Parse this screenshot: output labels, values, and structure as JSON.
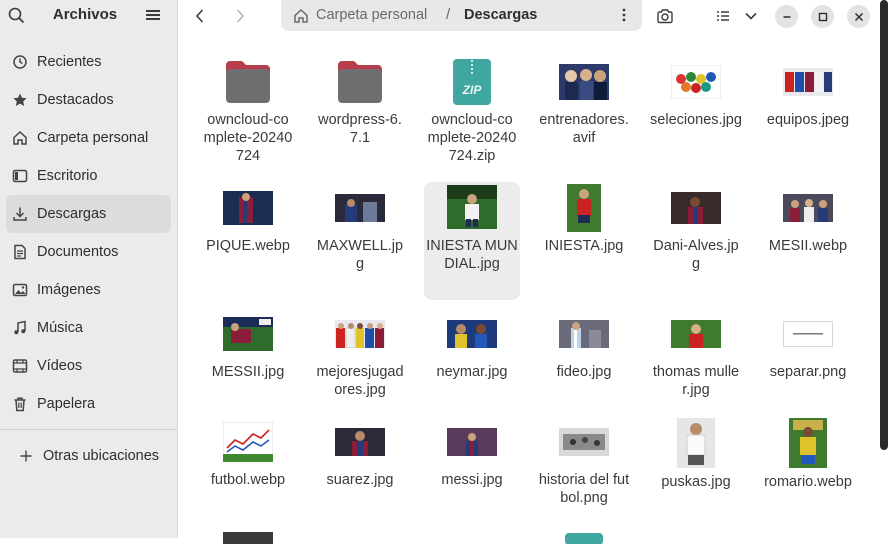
{
  "sidebar": {
    "title": "Archivos",
    "items": [
      {
        "label": "Recientes",
        "icon": "clock-icon"
      },
      {
        "label": "Destacados",
        "icon": "star-icon"
      },
      {
        "label": "Carpeta personal",
        "icon": "home-icon"
      },
      {
        "label": "Escritorio",
        "icon": "desktop-icon"
      },
      {
        "label": "Descargas",
        "icon": "download-icon",
        "active": true
      },
      {
        "label": "Documentos",
        "icon": "document-icon"
      },
      {
        "label": "Imágenes",
        "icon": "image-icon"
      },
      {
        "label": "Música",
        "icon": "music-icon"
      },
      {
        "label": "Vídeos",
        "icon": "video-icon"
      },
      {
        "label": "Papelera",
        "icon": "trash-icon"
      }
    ],
    "other": "Otras ubicaciones"
  },
  "path": {
    "home": "Carpeta personal",
    "separator": "/",
    "current": "Descargas"
  },
  "files": [
    {
      "name": "owncloud-complete-20240724",
      "type": "folder"
    },
    {
      "name": "wordpress-6.7.1",
      "type": "folder"
    },
    {
      "name": "owncloud-complete-20240724.zip",
      "type": "zip",
      "badge": "ZIP"
    },
    {
      "name": "entrenadores.avif",
      "type": "image"
    },
    {
      "name": "seleciones.jpg",
      "type": "image"
    },
    {
      "name": "equipos.jpeg",
      "type": "image"
    },
    {
      "name": "PIQUE.webp",
      "type": "image"
    },
    {
      "name": "MAXWELL.jpg",
      "type": "image"
    },
    {
      "name": "INIESTA MUNDIAL.jpg",
      "type": "image",
      "selected": true
    },
    {
      "name": "INIESTA.jpg",
      "type": "image"
    },
    {
      "name": "Dani-Alves.jpg",
      "type": "image"
    },
    {
      "name": "MESII.webp",
      "type": "image"
    },
    {
      "name": "MESSII.jpg",
      "type": "image"
    },
    {
      "name": "mejoresjugadores.jpg",
      "type": "image"
    },
    {
      "name": "neymar.jpg",
      "type": "image"
    },
    {
      "name": "fideo.jpg",
      "type": "image"
    },
    {
      "name": "thomas muller.jpg",
      "type": "image"
    },
    {
      "name": "separar.png",
      "type": "image"
    },
    {
      "name": "futbol.webp",
      "type": "image"
    },
    {
      "name": "suarez.jpg",
      "type": "image"
    },
    {
      "name": "messi.jpg",
      "type": "image"
    },
    {
      "name": "historia del futbol.png",
      "type": "image"
    },
    {
      "name": "puskas.jpg",
      "type": "image"
    },
    {
      "name": "romario.webp",
      "type": "image"
    }
  ],
  "colors": {
    "accent": "#4a90d9",
    "folder": "#6f6f6f",
    "folder_tab": "#b73c4c",
    "zip": "#3fa7a0"
  }
}
